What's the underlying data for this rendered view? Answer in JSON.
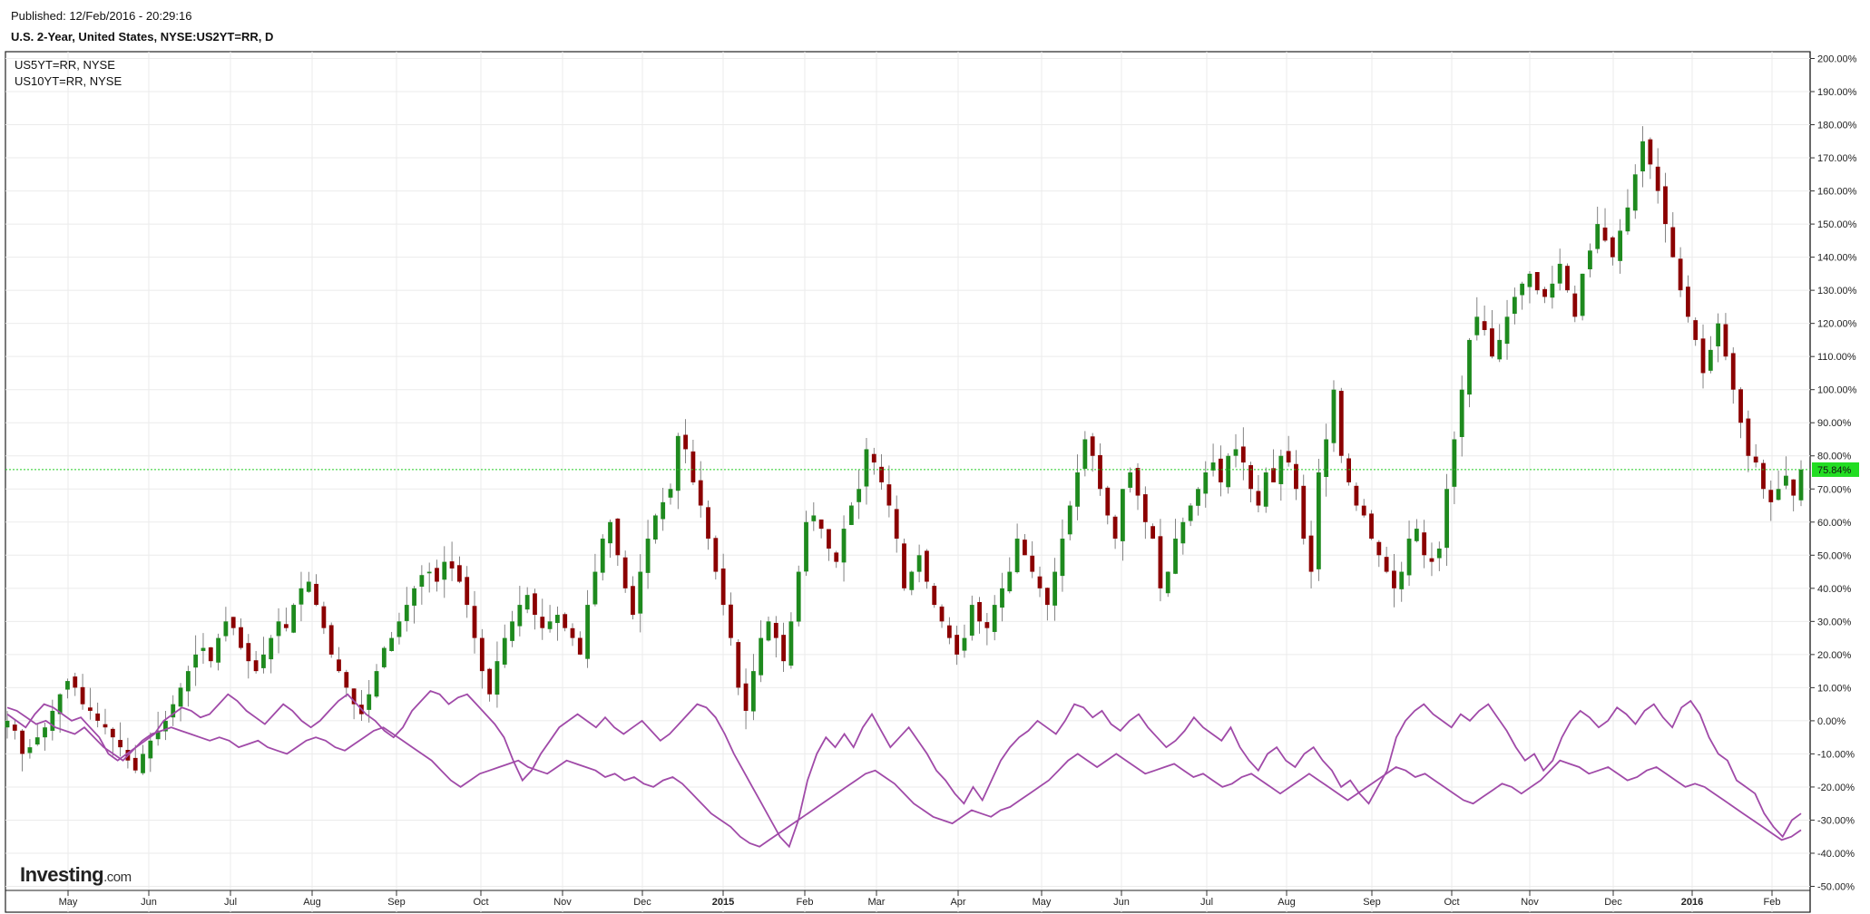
{
  "header": {
    "published": "Published: 12/Feb/2016 - 20:29:16",
    "title": "U.S. 2-Year, United States, NYSE:US2YT=RR, D"
  },
  "legend": {
    "items": [
      "US5YT=RR, NYSE",
      "US10YT=RR, NYSE"
    ]
  },
  "logo": {
    "brand": "Investing",
    "suffix": ".com"
  },
  "colors": {
    "up": "#1e8a1e",
    "down": "#8b0000",
    "comparison": "#a04aa8",
    "grid": "#ebebeb",
    "last_price_line": "#22cc22",
    "last_price_badge": "#22dd22"
  },
  "chart_data": {
    "type": "line",
    "subtype": "candlestick-with-comparison-lines",
    "title": "U.S. 2-Year, United States, NYSE:US2YT=RR, D",
    "ylabel": "",
    "ylim": [
      -50,
      200
    ],
    "y_ticks": [
      "200.00%",
      "190.00%",
      "180.00%",
      "170.00%",
      "160.00%",
      "150.00%",
      "140.00%",
      "130.00%",
      "120.00%",
      "110.00%",
      "100.00%",
      "90.00%",
      "80.00%",
      "70.00%",
      "60.00%",
      "50.00%",
      "40.00%",
      "30.00%",
      "20.00%",
      "10.00%",
      "0.00%",
      "-10.00%",
      "-20.00%",
      "-30.00%",
      "-40.00%",
      "-50.00%"
    ],
    "x_labels": [
      "May",
      "Jun",
      "Jul",
      "Aug",
      "Sep",
      "Oct",
      "Nov",
      "Dec",
      "2015",
      "Feb",
      "Mar",
      "Apr",
      "May",
      "Jun",
      "Jul",
      "Aug",
      "Sep",
      "Oct",
      "Nov",
      "Dec",
      "2016",
      "Feb"
    ],
    "bold_x_labels": [
      "2015",
      "2016"
    ],
    "grid": true,
    "legend_position": "top-left",
    "last_value": 75.84,
    "last_value_label": "75.84%",
    "series": [
      {
        "symbol": "US2YT=RR",
        "type": "candlestick",
        "closes_percent": [
          0,
          -3,
          -10,
          -8,
          -5,
          -2,
          3,
          8,
          12,
          10,
          5,
          3,
          0,
          -2,
          -5,
          -8,
          -12,
          -15,
          -10,
          -6,
          -3,
          0,
          5,
          10,
          15,
          20,
          22,
          18,
          25,
          30,
          28,
          22,
          18,
          15,
          20,
          25,
          30,
          28,
          35,
          40,
          42,
          35,
          28,
          20,
          15,
          10,
          5,
          2,
          8,
          15,
          22,
          25,
          30,
          35,
          40,
          44,
          45,
          42,
          48,
          46,
          42,
          35,
          25,
          15,
          8,
          18,
          25,
          30,
          35,
          38,
          32,
          28,
          30,
          32,
          28,
          25,
          20,
          35,
          45,
          55,
          60,
          50,
          40,
          32,
          45,
          55,
          62,
          66,
          70,
          86,
          82,
          72,
          65,
          55,
          45,
          35,
          25,
          10,
          3,
          15,
          25,
          30,
          25,
          18,
          30,
          45,
          60,
          62,
          58,
          52,
          48,
          58,
          65,
          70,
          82,
          78,
          72,
          65,
          55,
          40,
          45,
          50,
          42,
          35,
          30,
          25,
          20,
          25,
          35,
          30,
          28,
          35,
          40,
          45,
          55,
          50,
          45,
          40,
          35,
          45,
          55,
          65,
          75,
          85,
          80,
          70,
          62,
          55,
          70,
          75,
          68,
          60,
          55,
          40,
          45,
          55,
          60,
          65,
          70,
          75,
          78,
          72,
          80,
          82,
          78,
          70,
          65,
          75,
          72,
          80,
          78,
          70,
          55,
          45,
          75,
          85,
          100,
          80,
          72,
          65,
          62,
          55,
          50,
          45,
          40,
          45,
          55,
          58,
          50,
          48,
          52,
          70,
          85,
          100,
          115,
          122,
          118,
          110,
          115,
          122,
          128,
          132,
          135,
          130,
          128,
          132,
          138,
          130,
          122,
          135,
          142,
          150,
          145,
          140,
          148,
          155,
          165,
          175,
          168,
          160,
          150,
          140,
          130,
          122,
          115,
          105,
          112,
          120,
          110,
          100,
          90,
          80,
          78,
          70,
          66,
          70,
          74,
          68,
          75.84
        ]
      },
      {
        "symbol": "US5YT=RR",
        "type": "line",
        "values_percent": [
          2,
          0,
          -2,
          2,
          5,
          4,
          2,
          0,
          1,
          -2,
          -5,
          -10,
          -12,
          -10,
          -8,
          -6,
          -4,
          0,
          2,
          4,
          3,
          1,
          2,
          5,
          8,
          6,
          3,
          1,
          -1,
          2,
          5,
          3,
          0,
          -2,
          0,
          3,
          6,
          8,
          5,
          2,
          0,
          -3,
          -5,
          -2,
          3,
          6,
          9,
          8,
          5,
          7,
          8,
          5,
          2,
          -1,
          -5,
          -12,
          -18,
          -15,
          -10,
          -6,
          -2,
          0,
          2,
          0,
          -2,
          1,
          -2,
          -4,
          -2,
          0,
          -3,
          -6,
          -4,
          -1,
          2,
          5,
          4,
          1,
          -4,
          -10,
          -15,
          -20,
          -25,
          -30,
          -35,
          -38,
          -30,
          -18,
          -10,
          -5,
          -8,
          -4,
          -8,
          -2,
          2,
          -3,
          -8,
          -5,
          -2,
          -6,
          -10,
          -15,
          -18,
          -22,
          -25,
          -20,
          -24,
          -18,
          -12,
          -8,
          -5,
          -3,
          0,
          -2,
          -4,
          0,
          5,
          4,
          1,
          3,
          -1,
          -3,
          0,
          2,
          -2,
          -5,
          -8,
          -6,
          -3,
          1,
          -2,
          -4,
          -6,
          -2,
          -8,
          -12,
          -15,
          -10,
          -8,
          -12,
          -14,
          -10,
          -8,
          -12,
          -15,
          -20,
          -18,
          -22,
          -25,
          -20,
          -15,
          -5,
          0,
          3,
          5,
          2,
          0,
          -2,
          2,
          0,
          3,
          5,
          1,
          -3,
          -8,
          -12,
          -10,
          -15,
          -12,
          -5,
          0,
          3,
          1,
          -2,
          0,
          4,
          2,
          -1,
          3,
          5,
          1,
          -2,
          4,
          6,
          2,
          -5,
          -10,
          -12,
          -18,
          -20,
          -22,
          -28,
          -32,
          -35,
          -30,
          -28
        ]
      },
      {
        "symbol": "US10YT=RR",
        "type": "line",
        "values_percent": [
          4,
          3,
          1,
          -1,
          0,
          -2,
          -3,
          -4,
          -2,
          -5,
          -8,
          -10,
          -12,
          -9,
          -6,
          -4,
          -3,
          -2,
          -3,
          -4,
          -5,
          -6,
          -5,
          -6,
          -8,
          -7,
          -6,
          -8,
          -9,
          -10,
          -8,
          -6,
          -5,
          -6,
          -8,
          -9,
          -7,
          -5,
          -3,
          -2,
          -4,
          -6,
          -8,
          -10,
          -12,
          -15,
          -18,
          -20,
          -18,
          -16,
          -15,
          -14,
          -13,
          -12,
          -14,
          -15,
          -16,
          -14,
          -12,
          -13,
          -14,
          -15,
          -17,
          -16,
          -18,
          -17,
          -19,
          -20,
          -18,
          -17,
          -19,
          -22,
          -25,
          -28,
          -30,
          -32,
          -35,
          -37,
          -38,
          -36,
          -34,
          -32,
          -30,
          -28,
          -26,
          -24,
          -22,
          -20,
          -18,
          -16,
          -15,
          -17,
          -19,
          -22,
          -25,
          -27,
          -29,
          -30,
          -31,
          -29,
          -27,
          -28,
          -29,
          -27,
          -26,
          -24,
          -22,
          -20,
          -18,
          -15,
          -12,
          -10,
          -12,
          -14,
          -12,
          -10,
          -12,
          -14,
          -16,
          -15,
          -14,
          -13,
          -15,
          -17,
          -16,
          -18,
          -20,
          -19,
          -17,
          -16,
          -18,
          -20,
          -22,
          -20,
          -18,
          -16,
          -18,
          -20,
          -22,
          -24,
          -22,
          -20,
          -18,
          -16,
          -14,
          -15,
          -17,
          -16,
          -18,
          -20,
          -22,
          -24,
          -25,
          -23,
          -21,
          -19,
          -20,
          -22,
          -20,
          -18,
          -15,
          -12,
          -13,
          -14,
          -16,
          -15,
          -14,
          -16,
          -18,
          -17,
          -15,
          -14,
          -16,
          -18,
          -20,
          -19,
          -20,
          -22,
          -24,
          -26,
          -28,
          -30,
          -32,
          -34,
          -36,
          -35,
          -33
        ]
      }
    ]
  }
}
